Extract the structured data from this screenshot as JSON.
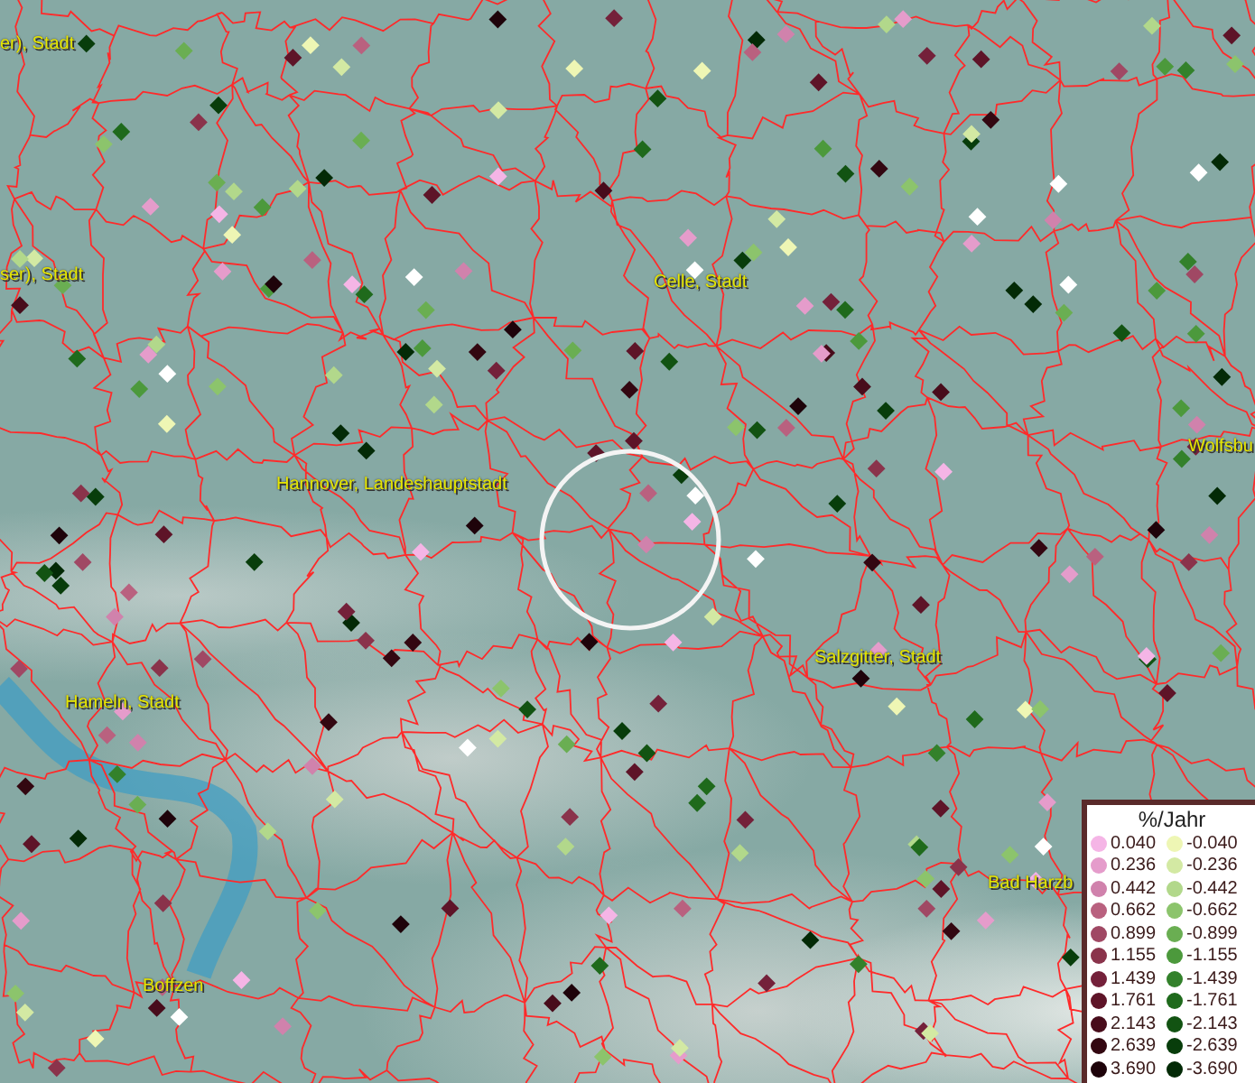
{
  "map": {
    "place_labels": [
      {
        "text": "er), Stadt"
      },
      {
        "text": "ser), Stadt"
      },
      {
        "text": "Celle, Stadt"
      },
      {
        "text": "Hannover, Landeshauptstadt"
      },
      {
        "text": "Wolfsbu"
      },
      {
        "text": "Hameln, Stadt"
      },
      {
        "text": "Salzgitter, Stadt"
      },
      {
        "text": "Bad Harzb"
      },
      {
        "text": "Boffzen"
      }
    ]
  },
  "legend": {
    "title": "%/Jahr",
    "positive": [
      {
        "label": "0.040",
        "color": "#f5b5e6"
      },
      {
        "label": "0.236",
        "color": "#e59ccb"
      },
      {
        "label": "0.442",
        "color": "#d082ac"
      },
      {
        "label": "0.662",
        "color": "#b9617f"
      },
      {
        "label": "0.899",
        "color": "#a04864"
      },
      {
        "label": "1.155",
        "color": "#8a334b"
      },
      {
        "label": "1.439",
        "color": "#74213a"
      },
      {
        "label": "1.761",
        "color": "#5e1428"
      },
      {
        "label": "2.143",
        "color": "#480c1b"
      },
      {
        "label": "2.639",
        "color": "#330711"
      },
      {
        "label": "3.690",
        "color": "#1e030a"
      }
    ],
    "negative": [
      {
        "label": "-0.040",
        "color": "#eef6b4"
      },
      {
        "label": "-0.236",
        "color": "#d3e9a3"
      },
      {
        "label": "-0.442",
        "color": "#b2d88b"
      },
      {
        "label": "-0.662",
        "color": "#8cc46c"
      },
      {
        "label": "-0.899",
        "color": "#6aae52"
      },
      {
        "label": "-1.155",
        "color": "#4c993c"
      },
      {
        "label": "-1.439",
        "color": "#33812b"
      },
      {
        "label": "-1.761",
        "color": "#1f6a1c"
      },
      {
        "label": "-2.143",
        "color": "#125312"
      },
      {
        "label": "-2.639",
        "color": "#083d0b"
      },
      {
        "label": "-3.690",
        "color": "#032a06"
      }
    ]
  }
}
